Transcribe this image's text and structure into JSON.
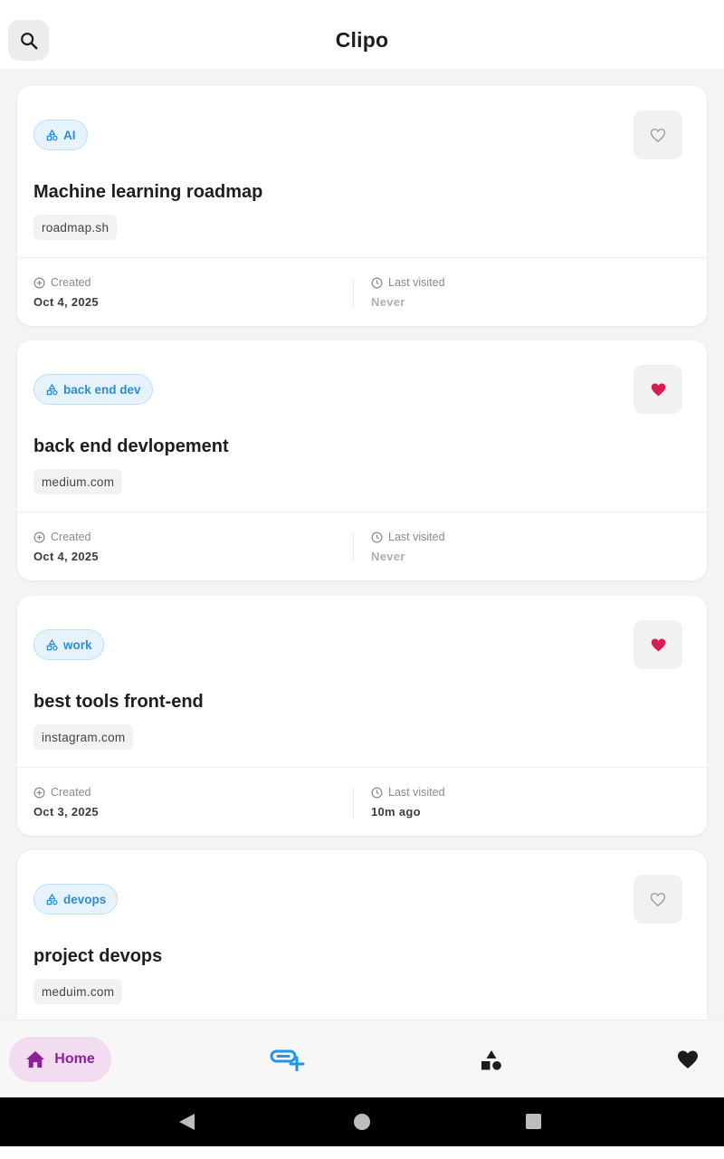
{
  "app_bar": {
    "title": "Clipo",
    "search_icon": "search-icon"
  },
  "colors": {
    "accent_purple": "#8e1f9a",
    "home_pill_bg": "#f2dcef",
    "tag_blue": "#2d8ed3",
    "heart_red": "#d81b55",
    "link_blue": "#2196e3"
  },
  "meta_labels": {
    "created": "Created",
    "last_visited": "Last visited"
  },
  "cards": [
    {
      "tag": "AI",
      "title": "Machine learning roadmap",
      "domain": "roadmap.sh",
      "favorite": false,
      "created": "Oct 4, 2025",
      "last_visited": "Never"
    },
    {
      "tag": "back end dev",
      "title": "back end devlopement",
      "domain": "medium.com",
      "favorite": true,
      "created": "Oct 4, 2025",
      "last_visited": "Never"
    },
    {
      "tag": "work",
      "title": "best tools front-end",
      "domain": "instagram.com",
      "favorite": true,
      "created": "Oct 3, 2025",
      "last_visited": "10m ago"
    },
    {
      "tag": "devops",
      "title": "project devops",
      "domain": "meduim.com",
      "favorite": false,
      "created": "",
      "last_visited": ""
    }
  ],
  "bottom_nav": {
    "home_label": "Home",
    "items": [
      "home-icon",
      "add-link-icon",
      "categories-icon",
      "favorites-heart-icon"
    ]
  }
}
